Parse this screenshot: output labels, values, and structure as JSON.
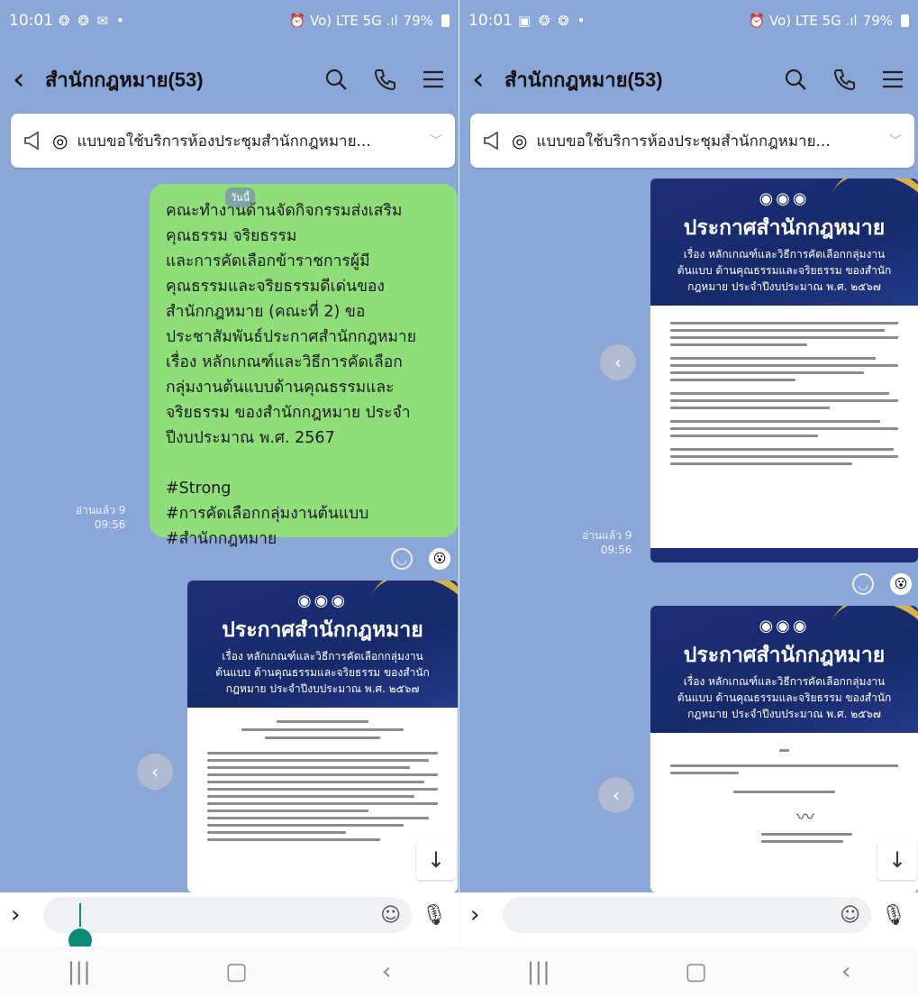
{
  "left": {
    "status": {
      "time": "10:01",
      "left_icons": "❂ ❂ ✉ •",
      "right_icons": "⏰ Vo) LTE 5G .ıl",
      "battery": "79%"
    },
    "header": {
      "title": "สำนักกฎหมาย(53)"
    },
    "announcement": {
      "text": "แบบขอใช้บริการห้องประชุมสำนักกฎหมาย..."
    },
    "date_chip": "วันนี้",
    "message": {
      "text": "คณะทำงานด้านจัดกิจกรรมส่งเสริม\nคุณธรรม จริยธรรม\nและการคัดเลือกข้าราชการผู้มี\nคุณธรรมและจริยธรรมดีเด่นของ\nสำนักกฎหมาย (คณะที่ 2) ขอ\nประชาสัมพันธ์ประกาศสำนักกฎหมาย\nเรื่อง หลักเกณฑ์และวิธีการคัดเลือก\nกลุ่มงานต้นแบบด้านคุณธรรมและ\nจริยธรรม ของสำนักกฎหมาย ประจำ\nปีงบประมาณ พ.ศ. 2567\n\n#Strong\n#การคัดเลือกกลุ่มงานต้นแบบ\n#สำนักกฎหมาย",
      "read_label": "อ่านแล้ว 9",
      "time": "09:56"
    },
    "card": {
      "title": "ประกาศสำนักกฎหมาย",
      "subtitle": "เรื่อง หลักเกณฑ์และวิธีการคัดเลือกกลุ่มงานต้นแบบ ด้านคุณธรรมและจริยธรรม ของสำนักกฎหมาย ประจำปีงบประมาณ พ.ศ. ๒๕๖๗"
    },
    "input": {
      "placeholder": ""
    }
  },
  "right": {
    "status": {
      "time": "10:01",
      "left_icons": "▣ ❂ ❂ •",
      "right_icons": "⏰ Vo) LTE 5G .ıl",
      "battery": "79%"
    },
    "header": {
      "title": "สำนักกฎหมาย(53)"
    },
    "announcement": {
      "text": "แบบขอใช้บริการห้องประชุมสำนักกฎหมาย..."
    },
    "card1": {
      "title": "ประกาศสำนักกฎหมาย",
      "subtitle": "เรื่อง หลักเกณฑ์และวิธีการคัดเลือกกลุ่มงานต้นแบบ ด้านคุณธรรมและจริยธรรม ของสำนักกฎหมาย ประจำปีงบประมาณ พ.ศ. ๒๕๖๗",
      "read_label": "อ่านแล้ว 9",
      "time": "09:56"
    },
    "card2": {
      "title": "ประกาศสำนักกฎหมาย",
      "subtitle": "เรื่อง หลักเกณฑ์และวิธีการคัดเลือกกลุ่มงานต้นแบบ ด้านคุณธรรมและจริยธรรม ของสำนักกฎหมาย ประจำปีงบประมาณ พ.ศ. ๒๕๖๗"
    }
  },
  "icons": {
    "back": "chevron-left-icon",
    "search": "search-icon",
    "call": "phone-icon",
    "menu": "menu-icon",
    "megaphone": "megaphone-icon",
    "smile": "smile-icon",
    "share": "share-icon",
    "down": "arrow-down-icon",
    "mic": "mic-icon",
    "expand": "chevron-right-icon"
  },
  "colors": {
    "chat_bg": "#8aa7d8",
    "bubble": "#8fde7a",
    "banner": "#1f2f77",
    "gold": "#d8b24a"
  }
}
